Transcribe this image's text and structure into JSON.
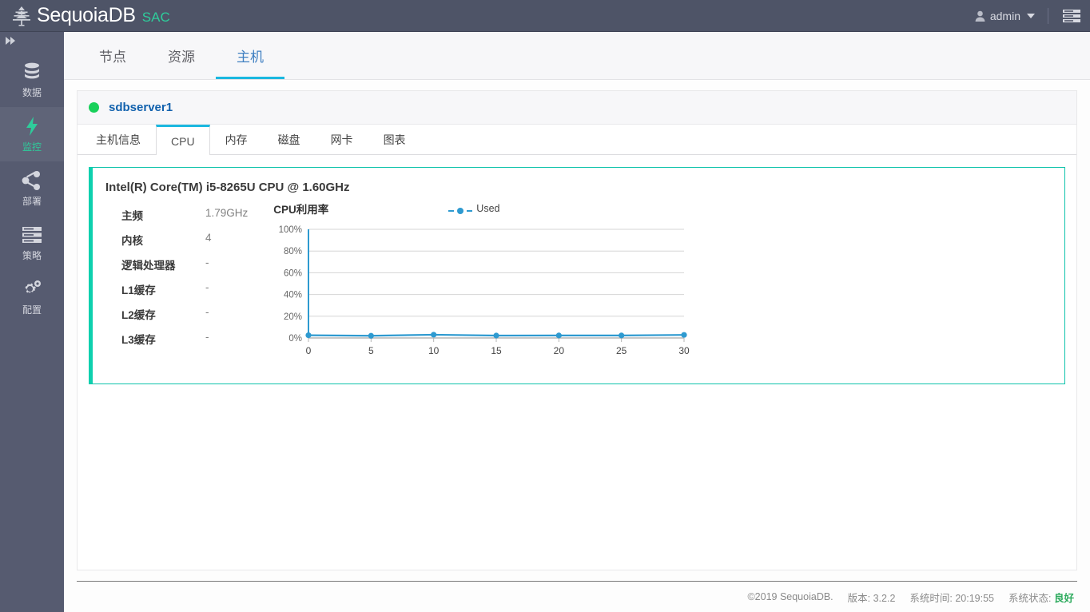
{
  "header": {
    "brand": "SequoiaDB",
    "brand_suffix": "SAC",
    "logo_icon": "tree-logo-icon",
    "user_name": "admin",
    "user_icon": "user-icon",
    "caret_icon": "chevron-down-icon",
    "menu_icon": "list-menu-icon"
  },
  "sidebar": {
    "collapse_icon": "double-chevron-right-icon",
    "items": [
      {
        "label": "数据",
        "icon": "database-icon",
        "active": false
      },
      {
        "label": "监控",
        "icon": "lightning-bolt-icon",
        "active": true
      },
      {
        "label": "部署",
        "icon": "share-nodes-icon",
        "active": false
      },
      {
        "label": "策略",
        "icon": "list-bars-icon",
        "active": false
      },
      {
        "label": "配置",
        "icon": "gears-icon",
        "active": false
      }
    ]
  },
  "topnav": {
    "items": [
      {
        "label": "节点",
        "active": false
      },
      {
        "label": "资源",
        "active": false
      },
      {
        "label": "主机",
        "active": true
      }
    ]
  },
  "server": {
    "status_icon": "status-dot-green",
    "name": "sdbserver1"
  },
  "tabs": [
    {
      "label": "主机信息",
      "active": false
    },
    {
      "label": "CPU",
      "active": true
    },
    {
      "label": "内存",
      "active": false
    },
    {
      "label": "磁盘",
      "active": false
    },
    {
      "label": "网卡",
      "active": false
    },
    {
      "label": "图表",
      "active": false
    }
  ],
  "cpu": {
    "model": "Intel(R) Core(TM) i5-8265U CPU @ 1.60GHz",
    "specs": [
      {
        "label": "主频",
        "value": "1.79GHz"
      },
      {
        "label": "内核",
        "value": "4"
      },
      {
        "label": "逻辑处理器",
        "value": "-"
      },
      {
        "label": "L1缓存",
        "value": "-"
      },
      {
        "label": "L2缓存",
        "value": "-"
      },
      {
        "label": "L3缓存",
        "value": "-"
      }
    ]
  },
  "footer": {
    "copyright": "©2019 SequoiaDB.",
    "version": "版本: 3.2.2",
    "system_time": "系统时间: 20:19:55",
    "system_status_label": "系统状态:",
    "system_status_value": "良好"
  },
  "colors": {
    "accent_cyan": "#1bb8e0",
    "brand_green": "#2ecc9b",
    "card_teal": "#0ec3ab",
    "series_blue": "#2e9ad0",
    "status_green": "#18d05a",
    "sidebar_bg": "#565b70",
    "header_bg": "#4e5467"
  },
  "chart_data": {
    "type": "line",
    "title": "CPU利用率",
    "xlabel": "",
    "ylabel": "",
    "x": [
      0,
      5,
      10,
      15,
      20,
      25,
      30
    ],
    "xticks": [
      "0",
      "5",
      "10",
      "15",
      "20",
      "25",
      "30"
    ],
    "yticks": [
      "0%",
      "20%",
      "40%",
      "60%",
      "80%",
      "100%"
    ],
    "ylim": [
      0,
      100
    ],
    "xlim": [
      0,
      30
    ],
    "grid": true,
    "legend_position": "top-right",
    "series": [
      {
        "name": "Used",
        "color": "#2e9ad0",
        "values": [
          2.5,
          2.0,
          3.0,
          2.2,
          2.3,
          2.3,
          2.8
        ]
      }
    ]
  }
}
